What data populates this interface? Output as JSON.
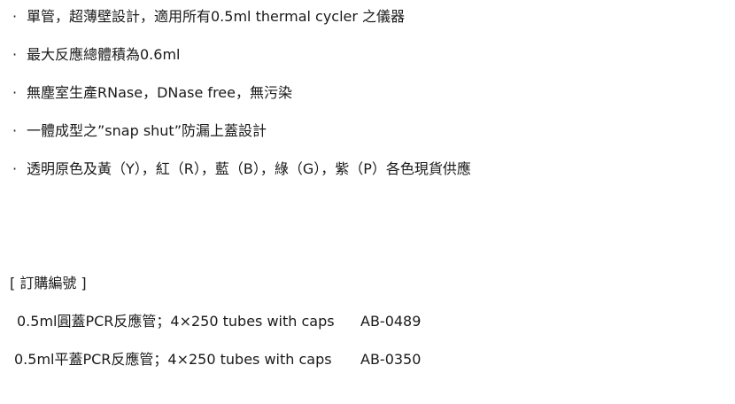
{
  "features": [
    "單管，超薄壁設計，適用所有0.5ml thermal cycler 之儀器",
    "最大反應總體積為0.6ml",
    "無塵室生產RNase，DNase free，無污染",
    "一體成型之”snap shut”防漏上蓋設計",
    "透明原色及黃（Y），紅（R），藍（B），綠（G），紫（P）各色現貨供應"
  ],
  "bullet_char": "·",
  "order_heading": "[ 訂購編號 ]",
  "orders": [
    {
      "name": "0.5ml圓蓋PCR反應管；4×250 tubes with caps",
      "code": "AB-0489"
    },
    {
      "name": "0.5ml平蓋PCR反應管；4×250 tubes with caps",
      "code": "AB-0350"
    }
  ]
}
